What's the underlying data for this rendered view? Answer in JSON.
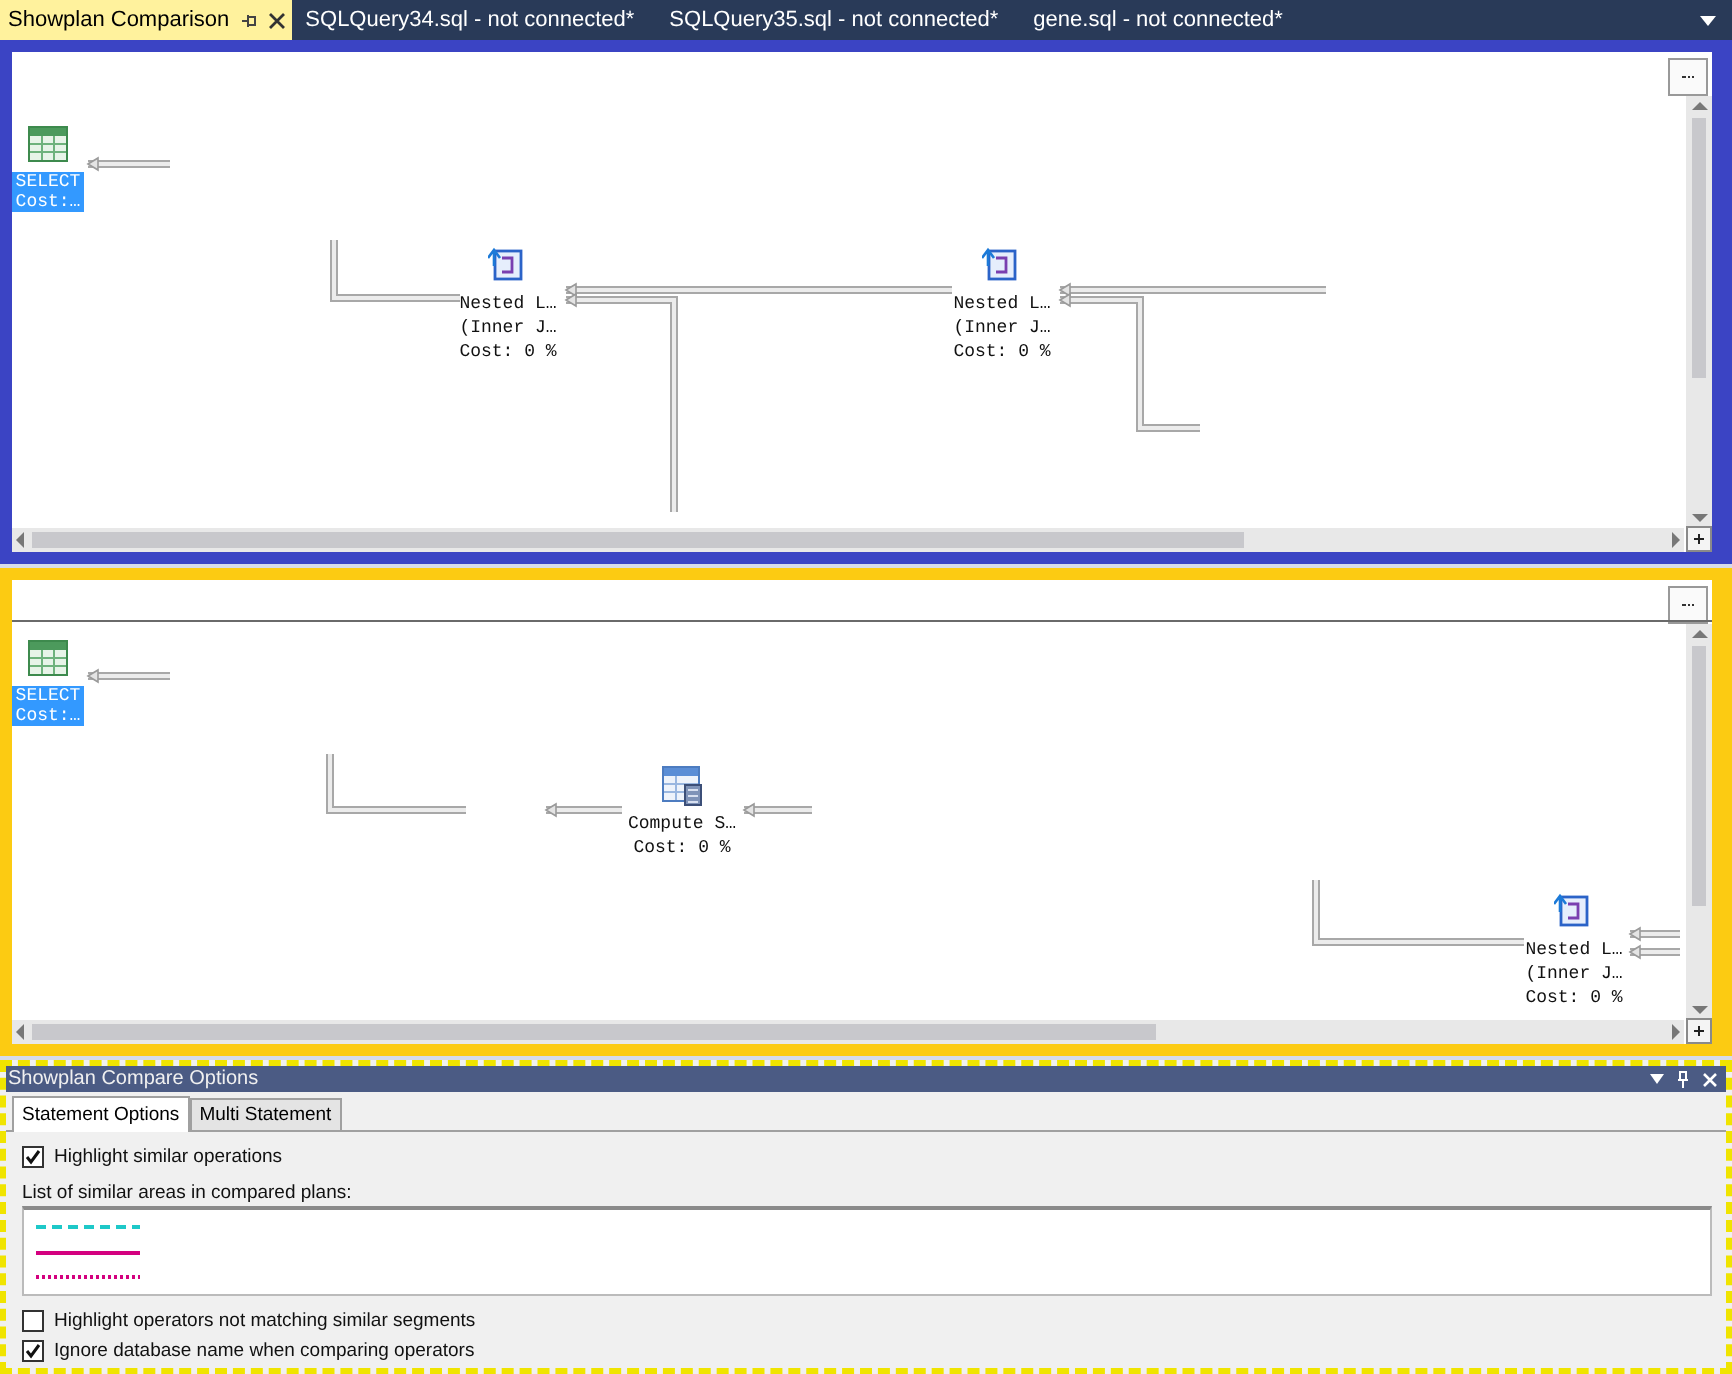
{
  "tabs": [
    {
      "label": "Showplan Comparison",
      "selected": true
    },
    {
      "label": "SQLQuery34.sql - not connected*",
      "selected": false
    },
    {
      "label": "SQLQuery35.sql - not connected*",
      "selected": false
    },
    {
      "label": "gene.sql - not connected*",
      "selected": false
    }
  ],
  "plans": [
    {
      "nodes": [
        {
          "kind": "select",
          "lines": [
            "SELECT",
            "Cost:…"
          ],
          "selected": true
        },
        {
          "kind": "nested_loops",
          "lines": [
            "Nested L…",
            "(Inner J…",
            "Cost: 0 %"
          ],
          "selected": false
        },
        {
          "kind": "nested_loops",
          "lines": [
            "Nested L…",
            "(Inner J…",
            "Cost: 0 %"
          ],
          "selected": false
        }
      ]
    },
    {
      "nodes": [
        {
          "kind": "select",
          "lines": [
            "SELECT",
            "Cost:…"
          ],
          "selected": true
        },
        {
          "kind": "compute_scalar",
          "lines": [
            "Compute S…",
            "Cost: 0 %"
          ],
          "selected": false
        },
        {
          "kind": "nested_loops",
          "lines": [
            "Nested L…",
            "(Inner J…",
            "Cost: 0 %"
          ],
          "selected": false
        }
      ]
    }
  ],
  "options_panel": {
    "title": "Showplan Compare Options",
    "tabs": [
      {
        "label": "Statement Options",
        "selected": true
      },
      {
        "label": "Multi Statement",
        "selected": false
      }
    ],
    "options_top": [
      {
        "label": "Highlight similar operations",
        "checked": true
      }
    ],
    "list_label": "List of similar areas in compared plans:",
    "similar_areas": [
      {
        "kind": "dashed",
        "color": "#1ec8c8"
      },
      {
        "kind": "solid",
        "color": "#d4007f"
      },
      {
        "kind": "dotted",
        "color": "#d4007f"
      }
    ],
    "options_bottom": [
      {
        "label": "Highlight operators not matching similar segments",
        "checked": false
      },
      {
        "label": "Ignore database name when comparing operators",
        "checked": true
      }
    ]
  }
}
